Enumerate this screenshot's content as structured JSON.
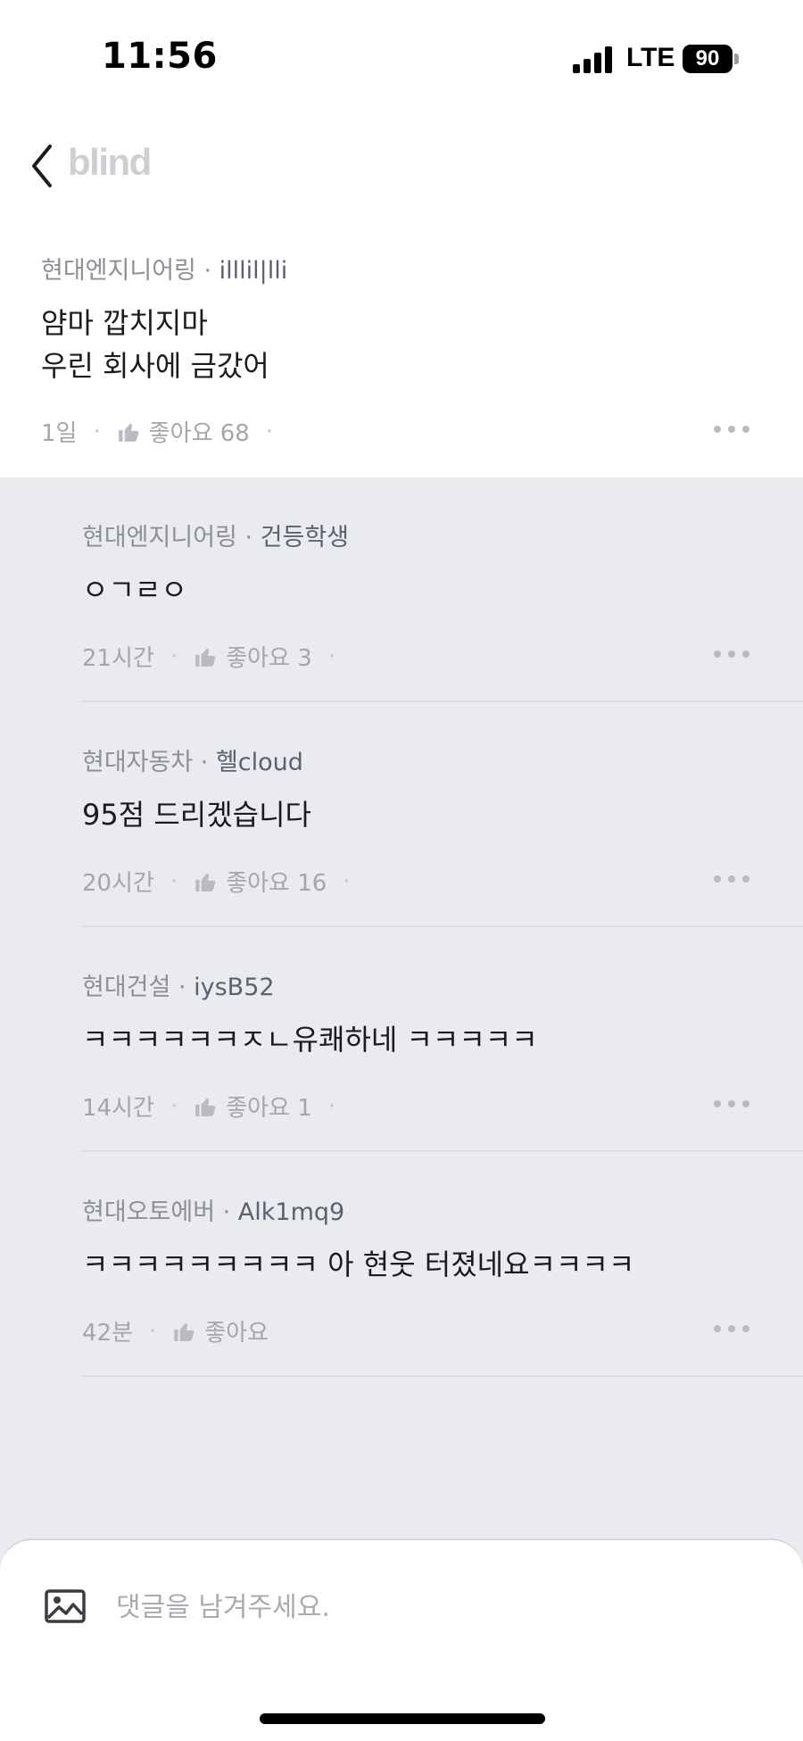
{
  "status_bar": {
    "time": "11:56",
    "network": "LTE",
    "battery": "90"
  },
  "nav": {
    "logo": "blind",
    "back_icon": "chevron-left-icon"
  },
  "post": {
    "company": "현대엔지니어링",
    "author": "illlil|lli",
    "lines": [
      "얌마 깝치지마",
      "우린 회사에 금갔어"
    ],
    "time": "1일",
    "like_label": "좋아요 68"
  },
  "replies": [
    {
      "company": "현대엔지니어링",
      "author": "건등학생",
      "text": "ㅇㄱㄹㅇ",
      "time": "21시간",
      "like_label": "좋아요 3"
    },
    {
      "company": "현대자동차",
      "author": "헬cloud",
      "text": "95점 드리겠습니다",
      "time": "20시간",
      "like_label": "좋아요 16"
    },
    {
      "company": "현대건설",
      "author": "iysB52",
      "text": "ㅋㅋㅋㅋㅋㅋㅈㄴ유쾌하네 ㅋㅋㅋㅋㅋ",
      "time": "14시간",
      "like_label": "좋아요 1"
    },
    {
      "company": "현대오토에버",
      "author": "Alk1mq9",
      "text": "ㅋㅋㅋㅋㅋㅋㅋㅋㅋ 아 현웃 터졌네요ㅋㅋㅋㅋ",
      "time": "42분",
      "like_label": "좋아요"
    }
  ],
  "input": {
    "placeholder": "댓글을 남겨주세요.",
    "image_icon": "image-icon"
  },
  "colors": {
    "background": "#e9ebef",
    "surface": "#ffffff",
    "text": "#1b1b1d",
    "muted": "#8d8f96"
  }
}
